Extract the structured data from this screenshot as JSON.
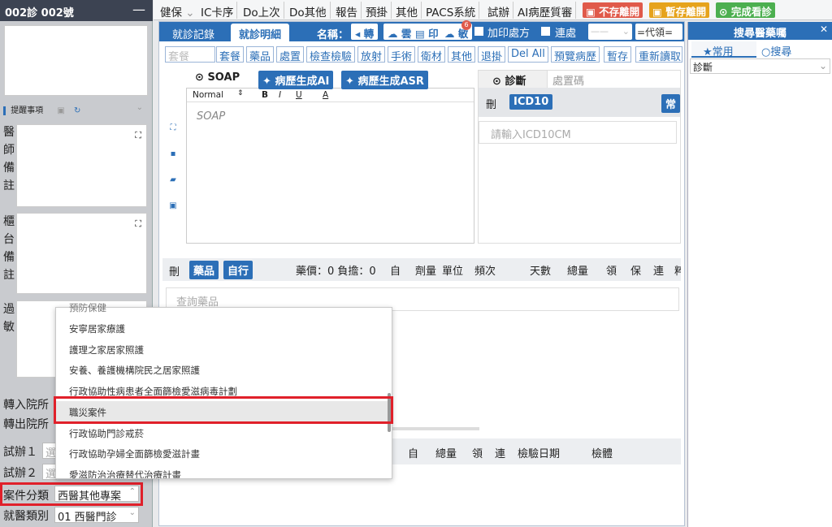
{
  "left": {
    "title": "002診 002號",
    "min": "—",
    "reminder": "提醒事項",
    "doctor_note": [
      "醫",
      "師",
      "備",
      "註"
    ],
    "counter_note": [
      "櫃",
      "台",
      "備",
      "註"
    ],
    "allergy": [
      "過",
      "敏"
    ],
    "transfer_in": "轉入院所",
    "transfer_out": "轉出院所",
    "trial1": "試辦１",
    "trial2": "試辦２",
    "trial_value": "選",
    "case_type_label": "案件分類",
    "case_type_value": "西醫其他專案",
    "visit_type_label": "就醫類別",
    "visit_type_value": "01 西醫門診"
  },
  "topbar": {
    "items": [
      "健保",
      "IC卡序",
      "Do上次",
      "Do其他",
      "報告",
      "預掛",
      "其他",
      "PACS系統",
      "試辦",
      "AI病歷質審"
    ],
    "no_save_leave": "不存離開",
    "temp_save_leave": "暫存離開",
    "finish": "完成看診"
  },
  "tabs": {
    "record": "就診記錄",
    "detail": "就診明細",
    "name_label": "名稱：",
    "btn_transfer": "轉",
    "btn_cloud": "雲",
    "btn_print": "印",
    "btn_allergy": "敏",
    "allergy_badge": "6",
    "add_print": "加印處方",
    "consecutive": "連處",
    "code_sel": "=代領="
  },
  "subbar": {
    "placeholder": "套餐",
    "items": [
      "套餐",
      "藥品",
      "處置",
      "檢查檢驗",
      "放射",
      "手術",
      "衛材",
      "其他",
      "退掛",
      "Del All",
      "預覽病歷",
      "暫存",
      "重新讀取"
    ]
  },
  "soap": {
    "tab": "SOAP",
    "gen_ai": "病歷生成AI",
    "gen_asr": "病歷生成ASR",
    "format": "Normal",
    "bold": "B",
    "italic": "I",
    "underline": "U",
    "color": "A",
    "placeholder": "SOAP"
  },
  "diag": {
    "tab": "診斷",
    "tab2": "處置碼",
    "del": "刪",
    "icd": "ICD10",
    "common": "常",
    "placeholder": "請輸入ICD10CM"
  },
  "meds": {
    "del": "刪",
    "drug": "藥品",
    "self": "自行",
    "price": "藥價：0 負擔：0",
    "cols": [
      "自",
      "劑量",
      "單位",
      "頻次",
      "天數",
      "總量",
      "領",
      "保",
      "連",
      "粹"
    ],
    "search": "查詢藥品"
  },
  "lab": {
    "cols": [
      "自",
      "總量",
      "領",
      "連",
      "檢驗日期",
      "檢體"
    ]
  },
  "right": {
    "title": "搜尋醫藥囑",
    "close": "✕",
    "tab_common": "常用",
    "tab_search": "搜尋",
    "select": "診斷"
  },
  "dropdown": {
    "items": [
      "預防保健",
      "安寧居家療護",
      "護理之家居家照護",
      "安養、養護機構院民之居家照護",
      "行政協助性病患者全面篩檢愛滋病毒計劃",
      "職災案件",
      "行政協助門診戒菸",
      "行政協助孕婦全面篩檢愛滋計畫",
      "愛滋防治治療替代治療計畫"
    ],
    "selected_index": 5
  },
  "colors": {
    "accent": "#2c6fb7",
    "danger": "#e05a4a",
    "warn": "#e6a31c",
    "ok": "#4caf50",
    "highlight": "#e0202a"
  }
}
